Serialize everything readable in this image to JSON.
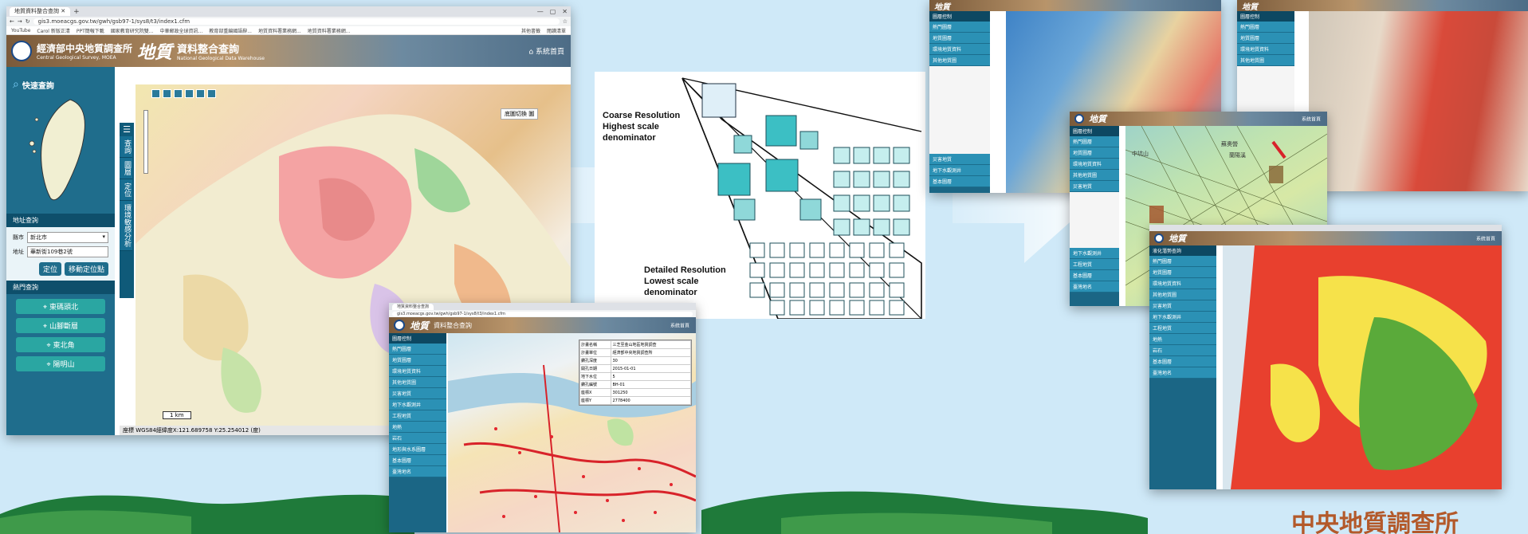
{
  "main_window": {
    "tab_title": "地質資料整合查詢",
    "url": "gis3.moeacgs.gov.tw/gwh/gsb97-1/sys8/t3/index1.cfm",
    "bookmarks": [
      "YouTube",
      "Carol 新版正清",
      "PPT簡報下載",
      "國家教育研究院雙...",
      "中華郵政全球資訊...",
      "教育部重編國語辭...",
      "地質資料署業務網...",
      "地質資料署業務網...",
      "其他書籤",
      "閱讀清單"
    ],
    "banner_org": "經濟部中央地質調查所",
    "banner_org_en": "Central Geological Survey, MOEA",
    "banner_title": "地質",
    "banner_subtitle": "資料整合查詢",
    "banner_subtitle_en": "National Geological Data Warehouse",
    "home_button": "系統首頁",
    "quick_search": "快速查詢",
    "address_search": "地址查詢",
    "county_label": "縣市",
    "county_value": "新北市",
    "address_label": "地址",
    "address_value": "華新街109巷2號",
    "locate_button": "定位",
    "move_locate_button": "移動定位點",
    "hot_search": "熱門查詢",
    "hot_items": [
      "東碼頭北",
      "山腳斷層",
      "東北角",
      "陽明山"
    ],
    "nav_items": [
      "查詢",
      "圖層",
      "定位",
      "環境敏感分析"
    ],
    "basemap_label": "底圖切換",
    "basemap_value": "圖",
    "scale_label": "1 km",
    "status_text": "WGS84經緯度X:121.689758 Y:25.254012 (度)",
    "status_prefix": "座標"
  },
  "pyramid": {
    "coarse_line1": "Coarse Resolution",
    "coarse_line2": "Highest scale",
    "coarse_line3": "denominator",
    "detailed_line1": "Detailed Resolution",
    "detailed_line2": "Lowest scale",
    "detailed_line3": "denominator"
  },
  "bottom_window": {
    "tab_title": "地質資料整合查詢",
    "url": "gis3.moeacgs.gov.tw/gwh/gsb97-1/sys8/t3/index1.cfm",
    "panel_header": "圖層控制",
    "panel_items": [
      "熱門圖層",
      "地質圖層",
      "環境地質資料",
      "其他地質圖",
      "災害地質",
      "地下水觀測井",
      "工程地質",
      "地熱",
      "岩石",
      "地形與水系圖層",
      "基本圖層",
      "臺灣地名"
    ],
    "home_button": "系統首頁",
    "info_rows": [
      [
        "計畫名稱",
        "三芝至金山地區地質調查"
      ],
      [
        "計畫單位",
        "經濟部中央地質調查所"
      ],
      [
        "鑽孔深度",
        "30"
      ],
      [
        "開孔日期",
        "2015-01-01"
      ],
      [
        "地下水位",
        "5"
      ],
      [
        "鑽孔編號",
        "BH-01"
      ],
      [
        "座標X",
        "301250"
      ],
      [
        "座標Y",
        "2778400"
      ]
    ]
  },
  "top_right_window_a": {
    "panel_header": "圖層控制",
    "panel_items": [
      "熱門圖層",
      "地質圖層",
      "環境地質資料",
      "其他地質圖",
      "災害地質",
      "地下水觀測井",
      "基本圖層"
    ]
  },
  "top_right_window_b": {
    "panel_header": "圖層控制",
    "panel_items": [
      "熱門圖層",
      "地質圖層",
      "環境地質資料",
      "其他地質圖"
    ]
  },
  "middle_right_window": {
    "panel_header": "圖層控制",
    "home_button": "系統首頁",
    "panel_items": [
      "熱門圖層",
      "地質圖層",
      "環境地質資料",
      "其他地質圖",
      "災害地質",
      "地下水觀測井",
      "工程地質",
      "基本圖層",
      "臺灣地名"
    ],
    "map_labels": [
      "蘇奧營",
      "中坑山",
      "蘭陽溪"
    ]
  },
  "bottom_right_window": {
    "panel_header": "液化潛勢查詢",
    "home_button": "系統首頁",
    "panel_items": [
      "熱門圖層",
      "地質圖層",
      "環境地質資料",
      "其他地質圖",
      "災害地質",
      "地下水觀測井",
      "工程地質",
      "地熱",
      "岩石",
      "基本圖層",
      "臺灣地名"
    ]
  },
  "footer_org": "中央地質調查所",
  "colors": {
    "sky": "#cfe9f8",
    "teal_nav": "#1f6d8c",
    "hill": "#1f7a3a",
    "footer_text": "#b3592a"
  }
}
